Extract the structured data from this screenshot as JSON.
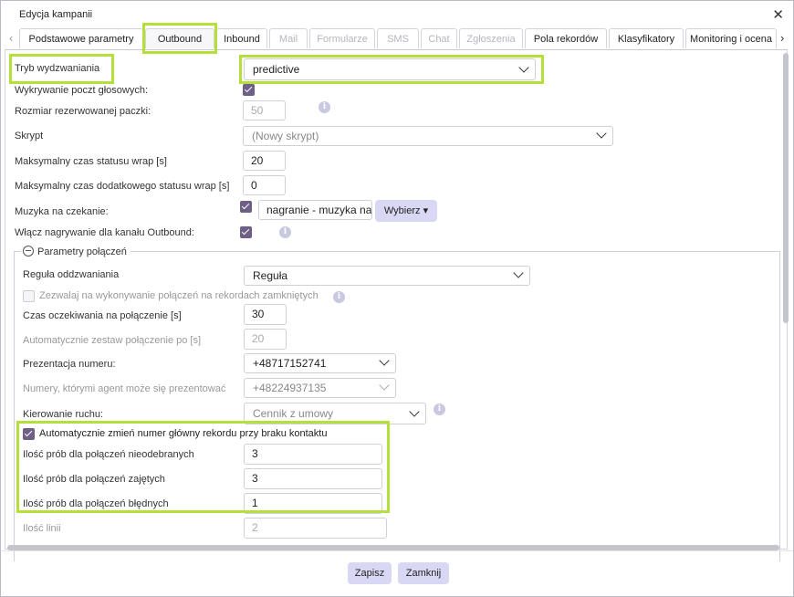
{
  "dialog": {
    "title": "Edycja kampanii"
  },
  "tabs": [
    {
      "label": "Podstawowe parametry",
      "disabled": false
    },
    {
      "label": "Outbound",
      "disabled": false
    },
    {
      "label": "Inbound",
      "disabled": false
    },
    {
      "label": "Mail",
      "disabled": true
    },
    {
      "label": "Formularze",
      "disabled": true
    },
    {
      "label": "SMS",
      "disabled": true
    },
    {
      "label": "Chat",
      "disabled": true
    },
    {
      "label": "Zgłoszenia",
      "disabled": true
    },
    {
      "label": "Pola rekordów",
      "disabled": false
    },
    {
      "label": "Klasyfikatory",
      "disabled": false
    },
    {
      "label": "Monitoring i ocena",
      "disabled": false
    }
  ],
  "icons": {
    "close": "close-icon",
    "tab_prev": "chevron-left-icon",
    "tab_next": "chevron-right-icon",
    "dropdown": "chevron-down-icon",
    "info": "info-icon",
    "check": "checkmark-icon",
    "collapse": "minus-circle-icon"
  },
  "colors": {
    "highlight": "#b5e03a",
    "checkbox": "#6e5f86",
    "button": "#d8d8f4",
    "info": "#c8c8e0"
  },
  "outbound": {
    "tryb_label": "Tryb wydzwaniania",
    "tryb_value": "predictive",
    "voicemail_label": "Wykrywanie poczt głosowych:",
    "voicemail_checked": true,
    "batch_label": "Rozmiar rezerwowanej paczki:",
    "batch_value": "50",
    "script_label": "Skrypt",
    "script_value": "(Nowy skrypt)",
    "wrap_label": "Maksymalny czas statusu wrap [s]",
    "wrap_value": "20",
    "extra_wrap_label": "Maksymalny czas dodatkowego statusu wrap [s]",
    "extra_wrap_value": "0",
    "music_label": "Muzyka na czekanie:",
    "music_checked": true,
    "music_value": "nagranie - muzyka na czekanie",
    "choose_label": "Wybierz",
    "choose_caret": "▾",
    "recording_label": "Włącz nagrywanie dla kanału Outbound:",
    "recording_checked": true
  },
  "connection_params": {
    "legend": "Parametry połączeń",
    "callback_label": "Reguła oddzwaniania",
    "callback_value": "Reguła",
    "closed_records_label": "Zezwalaj na wykonywanie połączeń na rekordach zamkniętych",
    "closed_records_checked": false,
    "wait_label": "Czas oczekiwania na połączenie [s]",
    "wait_value": "30",
    "auto_label": "Automatycznie zestaw połączenie po [s]",
    "auto_value": "20",
    "number_label": "Prezentacja numeru:",
    "number_value": "+48717152741",
    "agent_numbers_label": "Numery, którymi agent może się prezentować",
    "agent_numbers_value": "+48224937135",
    "routing_label": "Kierowanie ruchu:",
    "routing_value": "Cennik z umowy",
    "auto_change_label": "Automatycznie zmień numer główny rekordu przy braku kontaktu",
    "auto_change_checked": true,
    "noanswer_label": "Ilość prób dla połączeń nieodebranych",
    "noanswer_value": "3",
    "busy_label": "Ilość prób dla połączeń zajętych",
    "busy_value": "3",
    "failed_label": "Ilość prób dla połączeń błędnych",
    "failed_value": "1",
    "lines_label": "Ilość linii",
    "lines_value": "2"
  },
  "footer": {
    "save_label": "Zapisz",
    "close_label": "Zamknij"
  }
}
